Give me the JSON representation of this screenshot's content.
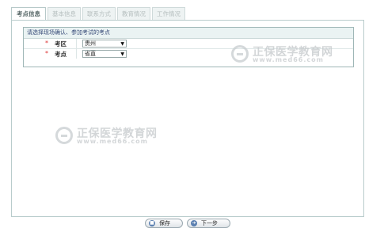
{
  "tabs": [
    {
      "label": "考点信息",
      "active": true
    },
    {
      "label": "基本信息",
      "active": false
    },
    {
      "label": "联系方式",
      "active": false
    },
    {
      "label": "教育情况",
      "active": false
    },
    {
      "label": "工作情况",
      "active": false
    }
  ],
  "section": {
    "title": "请选择现场确认、参加考试的考点",
    "rows": [
      {
        "star": "*",
        "label": "考区",
        "value": "贵州"
      },
      {
        "star": "*",
        "label": "考点",
        "value": "省直"
      }
    ]
  },
  "buttons": {
    "save_label": "保存",
    "next_label": "下一步"
  },
  "watermark": {
    "brand": "正保医学教育网",
    "url": "www.med66.com"
  },
  "colors": {
    "border": "#b9cccc",
    "section_header": "#eaf3f3",
    "required_star": "#dd3333"
  }
}
